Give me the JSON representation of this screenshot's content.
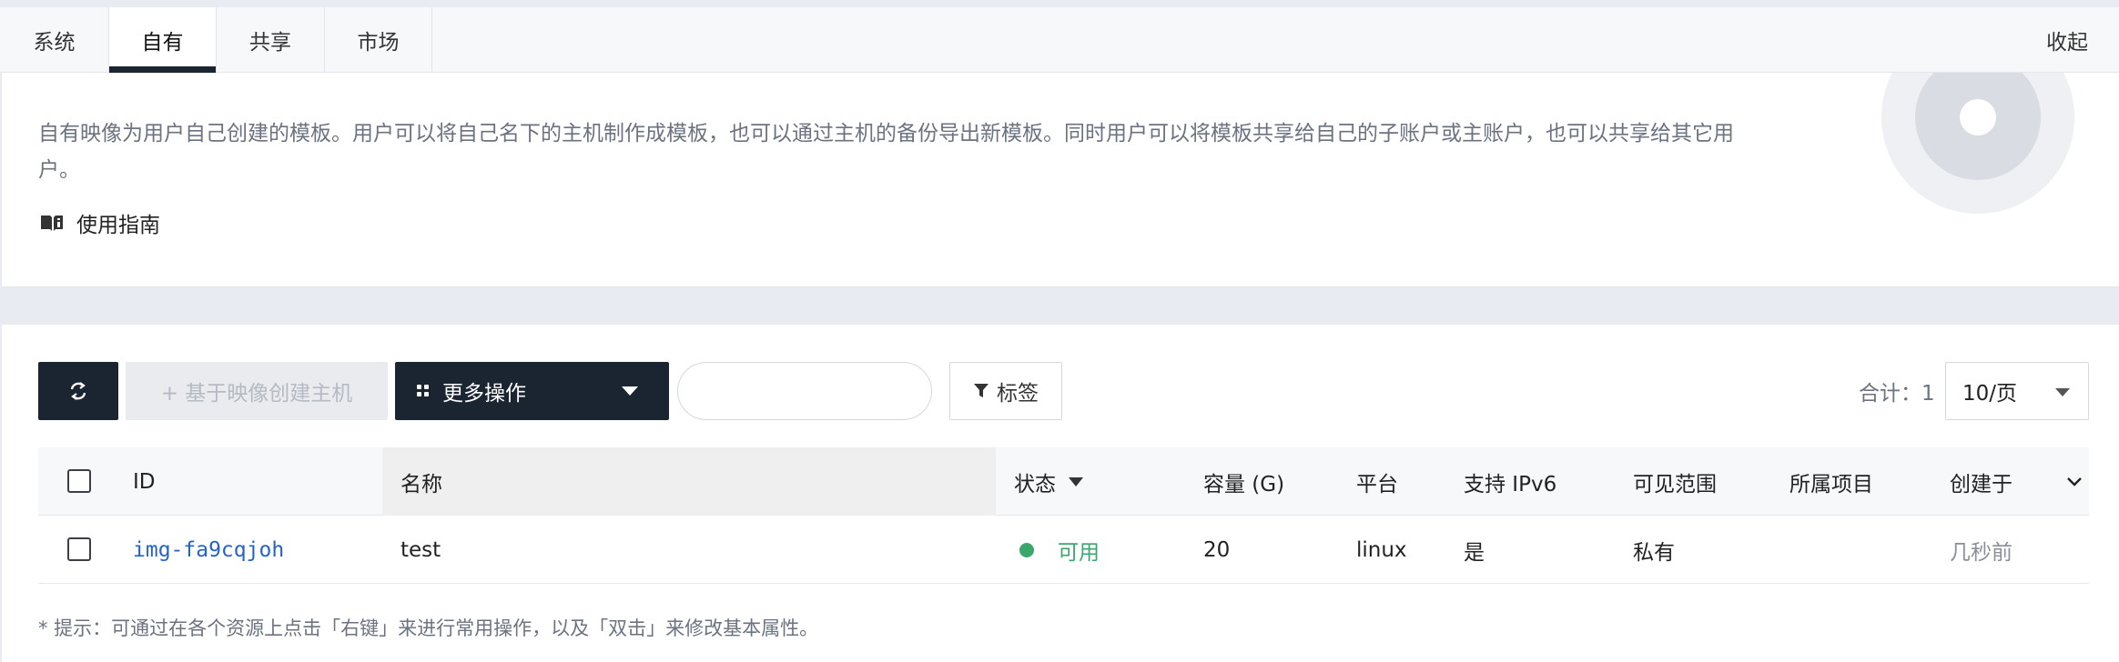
{
  "tabs": [
    {
      "label": "系统",
      "active": false
    },
    {
      "label": "自有",
      "active": true
    },
    {
      "label": "共享",
      "active": false
    },
    {
      "label": "市场",
      "active": false
    }
  ],
  "collapse_label": "收起",
  "description": {
    "text": "自有映像为用户自己创建的模板。用户可以将自己名下的主机制作成模板，也可以通过主机的备份导出新模板。同时用户可以将模板共享给自己的子账户或主账户，也可以共享给其它用户。",
    "guide_label": "使用指南"
  },
  "toolbar": {
    "refresh_icon": "refresh-icon",
    "create_label": "+ 基于映像创建主机",
    "more_label": "更多操作",
    "search_value": "",
    "tag_label": "标签",
    "total_label": "合计：1",
    "page_size": "10/页"
  },
  "table": {
    "columns": [
      "ID",
      "名称",
      "状态",
      "容量 (G)",
      "平台",
      "支持 IPv6",
      "可见范围",
      "所属项目",
      "创建于"
    ],
    "rows": [
      {
        "id": "img-fa9cqjoh",
        "name": "test",
        "status": "可用",
        "capacity": "20",
        "platform": "linux",
        "ipv6": "是",
        "visibility": "私有",
        "project": "",
        "created": "几秒前"
      }
    ]
  },
  "hint": "* 提示：可通过在各个资源上点击「右键」来进行常用操作，以及「双击」来修改基本属性。",
  "colors": {
    "dark": "#1b2431",
    "status_ok": "#3aa76d",
    "link": "#2563c9"
  }
}
